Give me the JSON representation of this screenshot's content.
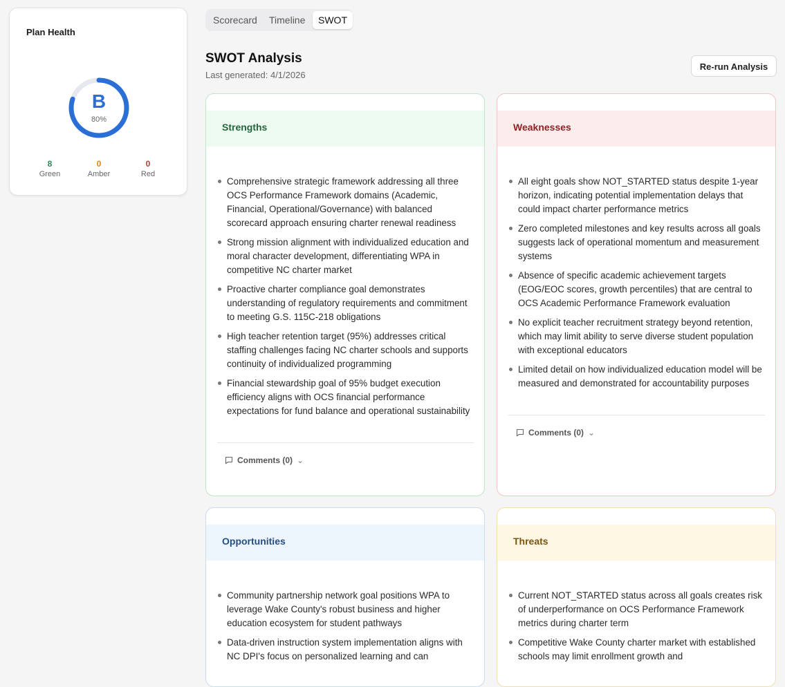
{
  "plan_health": {
    "title": "Plan Health",
    "grade": "B",
    "percent_label": "80%",
    "percent_value": 0.8,
    "green": {
      "count": "8",
      "label": "Green"
    },
    "amber": {
      "count": "0",
      "label": "Amber"
    },
    "red": {
      "count": "0",
      "label": "Red"
    },
    "accent_color": "#2b6fd6"
  },
  "tabs": [
    "Scorecard",
    "Timeline",
    "SWOT"
  ],
  "active_tab": "SWOT",
  "header": {
    "title": "SWOT Analysis",
    "last_generated": "Last generated: 4/1/2026",
    "rerun_label": "Re-run Analysis"
  },
  "strengths": {
    "title": "Strengths",
    "items": [
      "Comprehensive strategic framework addressing all three OCS Performance Framework domains (Academic, Financial, Operational/Governance) with balanced scorecard approach ensuring charter renewal readiness",
      "Strong mission alignment with individualized education and moral character development, differentiating WPA in competitive NC charter market",
      "Proactive charter compliance goal demonstrates understanding of regulatory requirements and commitment to meeting G.S. 115C-218 obligations",
      "High teacher retention target (95%) addresses critical staffing challenges facing NC charter schools and supports continuity of individualized programming",
      "Financial stewardship goal of 95% budget execution efficiency aligns with OCS financial performance expectations for fund balance and operational sustainability"
    ],
    "comments_label": "Comments (0)"
  },
  "weaknesses": {
    "title": "Weaknesses",
    "items": [
      "All eight goals show NOT_STARTED status despite 1-year horizon, indicating potential implementation delays that could impact charter performance metrics",
      "Zero completed milestones and key results across all goals suggests lack of operational momentum and measurement systems",
      "Absence of specific academic achievement targets (EOG/EOC scores, growth percentiles) that are central to OCS Academic Performance Framework evaluation",
      "No explicit teacher recruitment strategy beyond retention, which may limit ability to serve diverse student population with exceptional educators",
      "Limited detail on how individualized education model will be measured and demonstrated for accountability purposes"
    ],
    "comments_label": "Comments (0)"
  },
  "opportunities": {
    "title": "Opportunities",
    "items": [
      "Community partnership network goal positions WPA to leverage Wake County's robust business and higher education ecosystem for student pathways",
      "Data-driven instruction system implementation aligns with NC DPI's focus on personalized learning and can"
    ]
  },
  "threats": {
    "title": "Threats",
    "items": [
      "Current NOT_STARTED status across all goals creates risk of underperformance on OCS Performance Framework metrics during charter term",
      "Competitive Wake County charter market with established schools may limit enrollment growth and"
    ]
  }
}
